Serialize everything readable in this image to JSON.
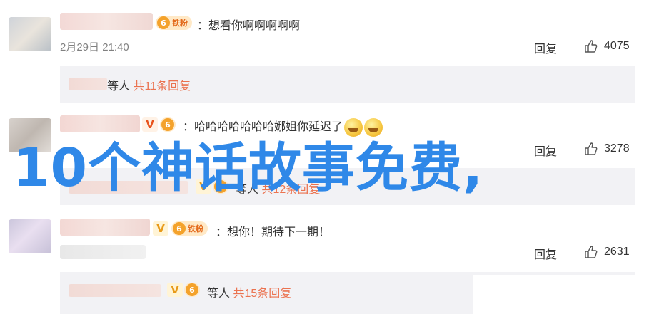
{
  "colors": {
    "accent": "#eb7350",
    "overlay_text": "#2f88e8",
    "reply_box_bg": "#f2f2f5"
  },
  "comments": [
    {
      "text": "：想看你啊啊啊啊啊",
      "date": "2月29日 21:40",
      "reply_label": "回复",
      "likes": "4075",
      "badges": [
        "fan-badge"
      ],
      "reply_summary": {
        "others": "等人",
        "link": "共11条回复"
      }
    },
    {
      "text": "：哈哈哈哈哈哈哈娜姐你延迟了",
      "reply_label": "回复",
      "likes": "3278",
      "badges": [
        "vip-badge",
        "fan-badge"
      ],
      "reply_summary": {
        "others": "等人",
        "link": "共12条回复"
      }
    },
    {
      "text": "：想你！期待下一期！",
      "reply_label": "回复",
      "likes": "2631",
      "badges": [
        "vip-badge",
        "fan-badge"
      ],
      "reply_summary": {
        "others": "等人",
        "link": "共15条回复"
      }
    }
  ],
  "fan_badge_label": "铁粉",
  "overlay_title": "10个神话故事免费,"
}
